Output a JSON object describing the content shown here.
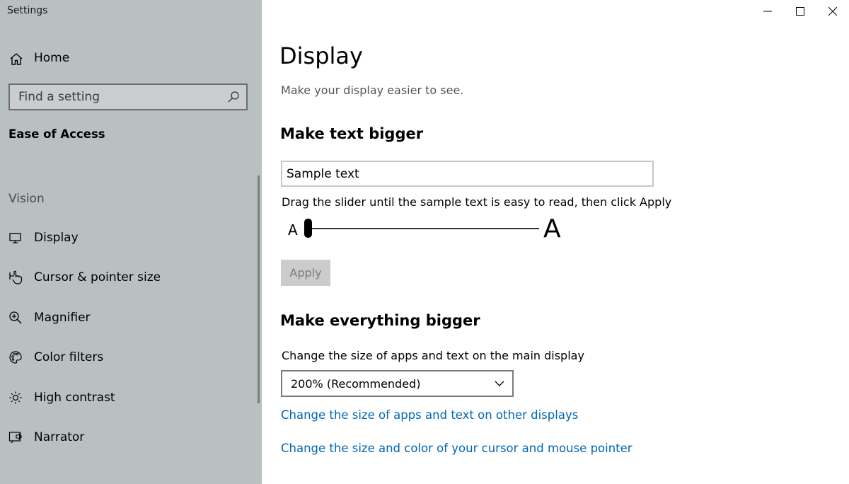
{
  "window": {
    "title": "Settings",
    "controls": {
      "minimize": "minimize-icon",
      "maximize": "maximize-icon",
      "close": "close-icon"
    }
  },
  "sidebar": {
    "home_label": "Home",
    "search": {
      "placeholder": "Find a setting",
      "value": ""
    },
    "category": "Ease of Access",
    "section": "Vision",
    "items": [
      {
        "label": "Display",
        "icon": "monitor-icon"
      },
      {
        "label": "Cursor & pointer size",
        "icon": "pointer-icon"
      },
      {
        "label": "Magnifier",
        "icon": "magnifier-icon"
      },
      {
        "label": "Color filters",
        "icon": "palette-icon"
      },
      {
        "label": "High contrast",
        "icon": "sun-icon"
      },
      {
        "label": "Narrator",
        "icon": "narrator-icon"
      }
    ]
  },
  "main": {
    "title": "Display",
    "subtitle": "Make your display easier to see.",
    "text_section": {
      "heading": "Make text bigger",
      "sample_text": "Sample text",
      "instruction": "Drag the slider until the sample text is easy to read, then click Apply",
      "small_a": "A",
      "large_a": "A",
      "slider_value_percent": 0,
      "apply_label": "Apply"
    },
    "everything_section": {
      "heading": "Make everything bigger",
      "field_label": "Change the size of apps and text on the main display",
      "dropdown_value": "200% (Recommended)",
      "links": [
        "Change the size of apps and text on other displays",
        "Change the size and color of your cursor and mouse pointer"
      ]
    }
  },
  "colors": {
    "sidebar_bg": "#b9c0c1",
    "accent_link": "#0066b4",
    "disabled_button": "#cccccc"
  }
}
